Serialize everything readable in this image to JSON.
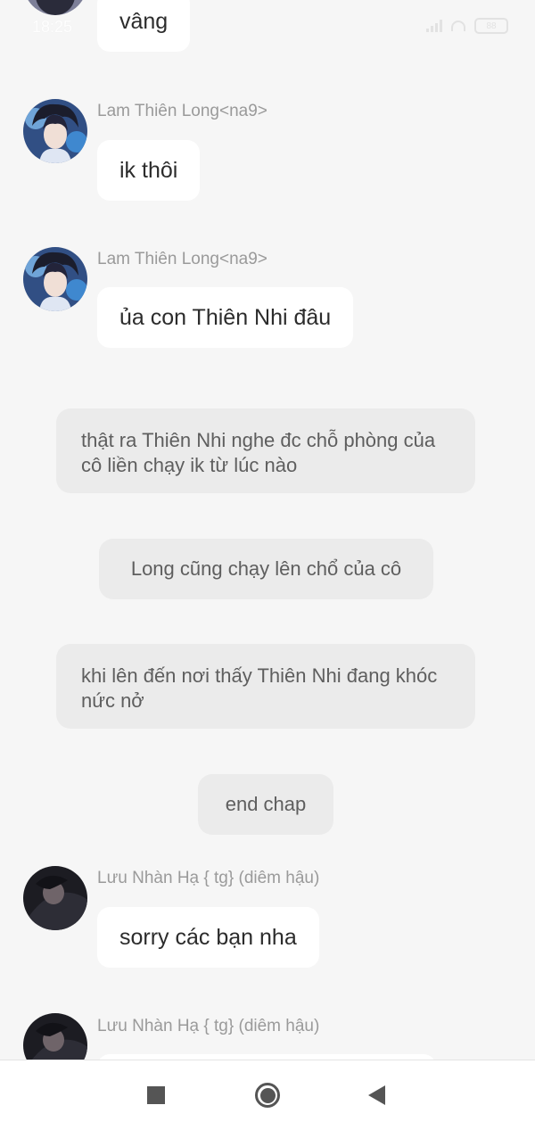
{
  "status_bar": {
    "time": "18:25",
    "battery": "88"
  },
  "chat": {
    "top_bubble": "vâng",
    "msg1": {
      "sender": "Lam Thiên Long<na9>",
      "text": "ik thôi"
    },
    "msg2": {
      "sender": "Lam Thiên Long<na9>",
      "text": "ủa con Thiên Nhi đâu"
    },
    "narration1": "thật ra Thiên Nhi nghe đc chỗ phòng của cô liền chạy ik từ lúc nào",
    "narration2": "Long cũng chạy lên chổ của cô",
    "narration3": "khi lên đến nơi thấy Thiên Nhi đang khóc nức nở",
    "narration4": "end chap",
    "msg3": {
      "sender": "Lưu Nhàn Hạ { tg} (diêm hậu)",
      "text": "sorry các bạn nha"
    },
    "msg4": {
      "sender": "Lưu Nhàn Hạ { tg} (diêm hậu)"
    }
  },
  "nav": {
    "recent_icon": "square-icon",
    "home_icon": "circle-icon",
    "back_icon": "triangle-back-icon"
  }
}
